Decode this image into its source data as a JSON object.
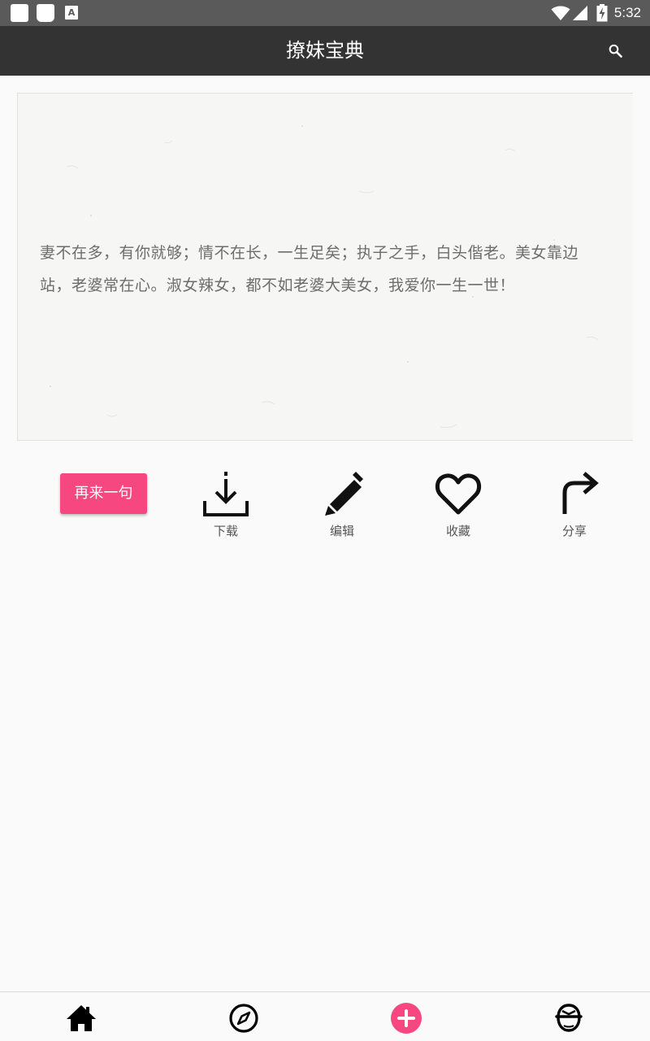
{
  "status_bar": {
    "time": "5:32",
    "icons": [
      "notification-square-icon",
      "notification-rounded-icon",
      "notification-a-icon",
      "wifi-icon",
      "signal-icon",
      "battery-charging-icon"
    ],
    "notif_letter": "A"
  },
  "app_bar": {
    "title": "撩妹宝典",
    "search_icon": "search-icon"
  },
  "quote": {
    "text": "妻不在多，有你就够；情不在长，一生足矣；执子之手，白头偕老。美女靠边站，老婆常在心。淑女辣女，都不如老婆大美女，我爱你一生一世！"
  },
  "actions": {
    "again_label": "再来一句",
    "download_label": "下载",
    "edit_label": "编辑",
    "favorite_label": "收藏",
    "share_label": "分享"
  },
  "bottom_nav": {
    "items": [
      "home-icon",
      "compass-icon",
      "add-icon",
      "profile-icon"
    ]
  },
  "colors": {
    "accent": "#f64781",
    "app_bar": "#333333",
    "status_bar": "#5a5a5a",
    "background": "#fafafa"
  }
}
